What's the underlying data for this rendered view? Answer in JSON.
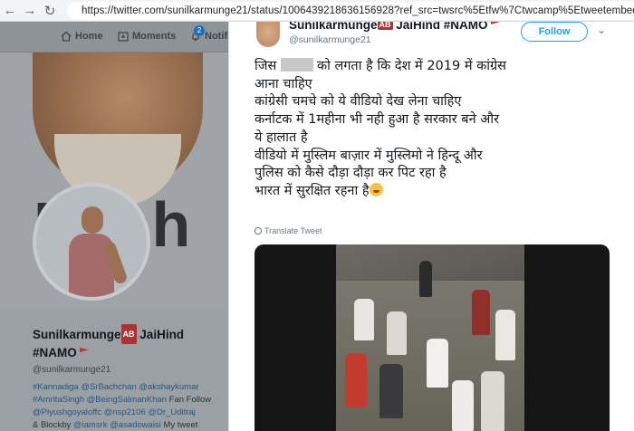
{
  "browser": {
    "url": "https://twitter.com/sunilkarmunge21/status/1006439218636156928?ref_src=twsrc%5Etfw%7Ctwcamp%5Etweetembed%7Ctwterm%5E1006"
  },
  "twitter_nav": {
    "home_label": "Home",
    "moments_label": "Moments",
    "notifications_label": "Notifi",
    "notifications_count": "2"
  },
  "profile": {
    "banner_text": "Pash",
    "name": "Sunilkarmunge",
    "name_badge": "AB",
    "name_suffix": "JaiHind",
    "name_tag": "#NAMO",
    "handle": "@sunilkarmunge21",
    "bio_line1_tags": "#Kannadiga @SrBachchan @akshaykumar",
    "bio_line2_tags": "#AmritaSingh @BeingSalmanKhan",
    "bio_line2_text": " Fan Follow",
    "bio_line3_tags": "@Piyushgoyaloffc @nsp2106 @Dr_Uditraj",
    "bio_line4_text": "& Blockby",
    "bio_line4_tags": " @iamsrk @asadowaisi",
    "bio_line4_end": " My tweet"
  },
  "tweet": {
    "author_name": "SunilkarmungeAB JaiHind #NAMO",
    "author_name_part1": "Sunilkarmunge",
    "author_badge": "AB",
    "author_name_part2": " JaiHind #NAMO",
    "author_handle": "@sunilkarmunge21",
    "follow_label": "Follow",
    "text_line1_a": "जिस",
    "text_line1_b": "को लगता है कि देश में 2019 में कांग्रेस",
    "text_line2": "आना चाहिए",
    "text_line3": "कांग्रेसी चमचे को ये वीडियो देख लेना चाहिए",
    "text_line4": "कर्नाटक में 1महीना भी नही हुआ है सरकार बने और",
    "text_line5": "ये हालात है",
    "text_line6": "वीडियो में मुस्लिम बाज़ार में मुस्लिमो ने हिन्दू और",
    "text_line7": "पुलिस को कैसे दौड़ा दौड़ा कर पिट रहा है",
    "text_line8": "भारत में सुरक्षित रहना है",
    "translate_label": "Translate Tweet"
  },
  "colors": {
    "link": "#1da1f2",
    "text": "#14171a",
    "muted": "#657786"
  }
}
